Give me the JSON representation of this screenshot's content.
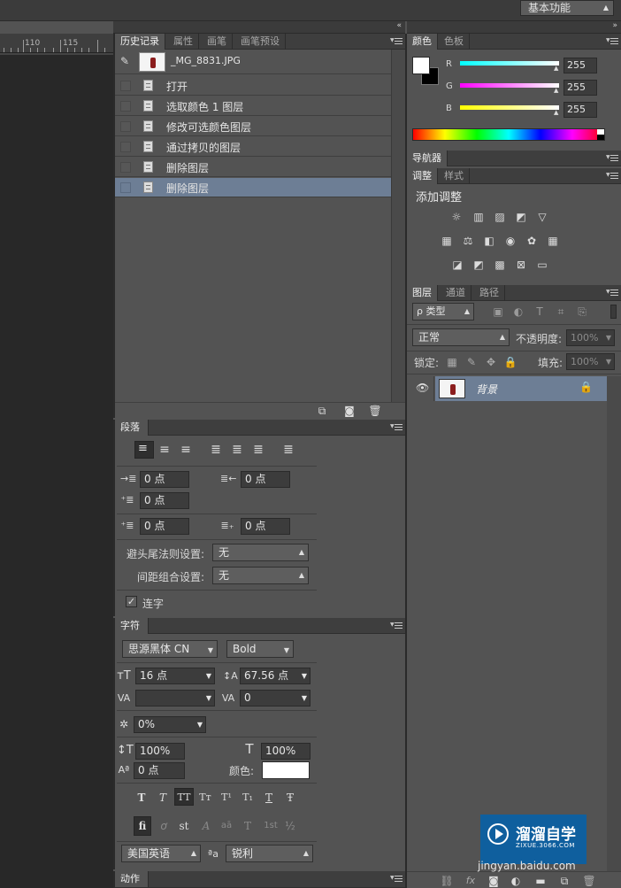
{
  "topbar": {
    "workspace": "基本功能"
  },
  "ruler": {
    "marks": [
      "110",
      "115"
    ]
  },
  "history": {
    "tabs": [
      "历史记录",
      "属性",
      "画笔",
      "画笔预设"
    ],
    "snapshot_name": "_MG_8831.JPG",
    "rows": [
      "打开",
      "选取颜色 1 图层",
      "修改可选颜色图层",
      "通过拷贝的图层",
      "删除图层",
      "删除图层"
    ]
  },
  "paragraph": {
    "tab": "段落",
    "indent_left": "0 点",
    "indent_right": "0 点",
    "indent_first": "0 点",
    "space_before": "0 点",
    "space_after": "0 点",
    "kinsoku_label": "避头尾法则设置:",
    "kinsoku_value": "无",
    "mojikumi_label": "间距组合设置:",
    "mojikumi_value": "无",
    "hyphenate_label": "连字"
  },
  "character": {
    "tab": "字符",
    "font_family": "思源黑体 CN",
    "font_style": "Bold",
    "font_size": "16 点",
    "leading": "67.56 点",
    "kerning": "",
    "tracking": "0",
    "tsume": "0%",
    "vscale": "100%",
    "hscale": "100%",
    "baseline": "0 点",
    "color_label": "颜色:",
    "style_buttons": [
      "T",
      "T",
      "TT",
      "Tт",
      "T¹",
      "T₁",
      "T",
      "Ŧ"
    ],
    "opentype_buttons": [
      "fi",
      "ơ",
      "st",
      "A",
      "aā",
      "T",
      "1st",
      "½"
    ],
    "language": "美国英语",
    "aa_icon": "ªa",
    "antialias": "锐利"
  },
  "actions": {
    "tab": "动作"
  },
  "color_panel": {
    "tabs": [
      "颜色",
      "色板"
    ],
    "channels": [
      {
        "name": "R",
        "value": "255"
      },
      {
        "name": "G",
        "value": "255"
      },
      {
        "name": "B",
        "value": "255"
      }
    ],
    "foreground": "#ffffff",
    "background": "#000000"
  },
  "navigator": {
    "tab": "导航器"
  },
  "adjustments": {
    "tabs": [
      "调整",
      "样式"
    ],
    "title": "添加调整"
  },
  "layers": {
    "tabs": [
      "图层",
      "通道",
      "路径"
    ],
    "filter_kind": "ρ 类型",
    "blend_mode": "正常",
    "opacity_label": "不透明度:",
    "opacity_value": "100%",
    "lock_label": "锁定:",
    "fill_label": "填充:",
    "fill_value": "100%",
    "layer_name": "背景"
  },
  "watermark": {
    "brand": "溜溜自学",
    "url": "ZIXUE.3066.COM",
    "sub": "jingyan.baidu.com"
  }
}
